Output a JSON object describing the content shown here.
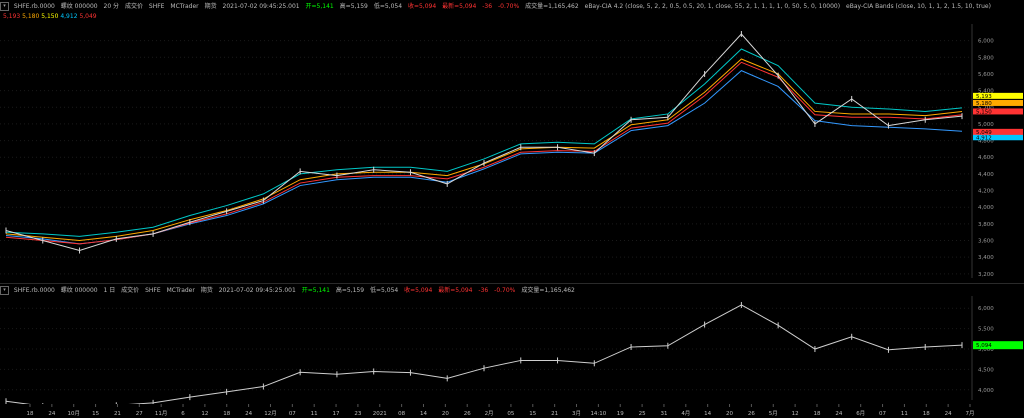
{
  "pane1_header": {
    "symbol": "SHFE.rb.0000",
    "name": "螺纹 000000",
    "interval": "20 分",
    "type": "成交价",
    "feed": "SHFE",
    "platform": "MCTrader",
    "session": "期货",
    "datetime": "2021-07-02  09:45:25.001",
    "open": "开=5,141",
    "high": "高=5,159",
    "low": "低=5,054",
    "close": "收=5,094",
    "last": "最新=5,094",
    "change": "-36",
    "change_pct": "-0.70%",
    "volume": "成交量=1,165,462",
    "strategy": "eBay-CIA 4.2 (close, 5, 2, 2, 0.5, 0.5, 20, 1, close, 55, 2, 1, 1, 1, 1, 0, 50, 5, 0, 10000)",
    "indicator": "eBay-CIA Bands   (close, 10, 1, 1, 2, 1.5, 10, true)",
    "band_values": [
      "5,193",
      "5,180",
      "5,150",
      "4,912",
      "5,049"
    ]
  },
  "pane2_header": {
    "symbol": "SHFE.rb.0000",
    "name": "螺纹 000000",
    "interval": "1 日",
    "type": "成交价",
    "feed": "SHFE",
    "platform": "MCTrader",
    "session": "期货",
    "datetime": "2021-07-02  09:45:25.001",
    "open": "开=5,141",
    "high": "高=5,159",
    "low": "低=5,054",
    "close": "收=5,094",
    "last": "最新=5,094",
    "change": "-36",
    "change_pct": "-0.70%",
    "volume": "成交量=1,165,462"
  },
  "x_axis_labels": [
    "18",
    "24",
    "10月",
    "15",
    "21",
    "27",
    "11月",
    "6",
    "12",
    "18",
    "24",
    "12月",
    "07",
    "11",
    "17",
    "23",
    "2021",
    "08",
    "14",
    "20",
    "26",
    "2月",
    "05",
    "15",
    "21",
    "3月",
    "14:10",
    "19",
    "25",
    "31",
    "4月",
    "14",
    "20",
    "26",
    "5月",
    "12",
    "18",
    "24",
    "6月",
    "07",
    "11",
    "18",
    "24",
    "7月"
  ],
  "chart_data": [
    {
      "type": "line",
      "title": "SHFE.rb.0000 螺纹 000000 20 分",
      "series": [
        {
          "name": "close",
          "color": "#d8d8d8"
        },
        {
          "name": "eBay-CIA Bands",
          "color": "#ff3333"
        }
      ],
      "x": [
        "2020-09-18",
        "2020-10-01",
        "2020-10-15",
        "2020-10-27",
        "2020-11-06",
        "2020-11-18",
        "2020-12-01",
        "2020-12-11",
        "2020-12-23",
        "2021-01-08",
        "2021-01-20",
        "2021-02-01",
        "2021-02-15",
        "2021-02-25",
        "2021-03-10",
        "2021-03-25",
        "2021-04-01",
        "2021-04-14",
        "2021-04-26",
        "2021-05-08",
        "2021-05-12",
        "2021-05-18",
        "2021-05-26",
        "2021-06-07",
        "2021-06-18",
        "2021-06-24",
        "2021-07-02"
      ],
      "close": [
        3720,
        3600,
        3480,
        3620,
        3680,
        3820,
        3950,
        4080,
        4430,
        4380,
        4450,
        4420,
        4280,
        4530,
        4720,
        4720,
        4650,
        5050,
        5080,
        5600,
        6080,
        5580,
        5000,
        5300,
        4980,
        5050,
        5094
      ],
      "bands": {
        "upper": [
          3700,
          3680,
          3650,
          3700,
          3760,
          3900,
          4020,
          4160,
          4400,
          4450,
          4480,
          4480,
          4430,
          4580,
          4760,
          4780,
          4760,
          5060,
          5120,
          5480,
          5900,
          5700,
          5250,
          5200,
          5180,
          5150,
          5193
        ],
        "middle": [
          3680,
          3640,
          3600,
          3650,
          3720,
          3850,
          3960,
          4100,
          4330,
          4400,
          4420,
          4420,
          4380,
          4520,
          4700,
          4720,
          4710,
          4990,
          5050,
          5380,
          5780,
          5600,
          5150,
          5120,
          5120,
          5100,
          5150
        ],
        "lower": [
          3660,
          3620,
          3560,
          3610,
          3680,
          3800,
          3900,
          4040,
          4260,
          4330,
          4360,
          4360,
          4300,
          4460,
          4640,
          4660,
          4650,
          4920,
          4980,
          5250,
          5640,
          5450,
          5040,
          4980,
          4960,
          4940,
          4912
        ]
      },
      "y_ticks": [
        3200,
        3400,
        3600,
        3800,
        4000,
        4200,
        4400,
        4600,
        4800,
        5000,
        5200,
        5400,
        5600,
        5800,
        6000
      ],
      "ylim": [
        3150,
        6200
      ]
    },
    {
      "type": "line",
      "title": "SHFE.rb.0000 螺纹 000000 1 日",
      "series": [
        {
          "name": "daily",
          "color": "#cfcfcf"
        }
      ],
      "x": [
        "2020-09-18",
        "2020-10-01",
        "2020-10-15",
        "2020-10-27",
        "2020-11-06",
        "2020-11-18",
        "2020-12-01",
        "2020-12-11",
        "2020-12-23",
        "2021-01-08",
        "2021-01-20",
        "2021-02-01",
        "2021-02-15",
        "2021-02-25",
        "2021-03-10",
        "2021-03-25",
        "2021-04-01",
        "2021-04-14",
        "2021-04-26",
        "2021-05-08",
        "2021-05-12",
        "2021-05-18",
        "2021-05-26",
        "2021-06-07",
        "2021-06-18",
        "2021-06-24",
        "2021-07-02"
      ],
      "values": [
        3720,
        3600,
        3480,
        3620,
        3680,
        3820,
        3950,
        4080,
        4430,
        4380,
        4450,
        4420,
        4280,
        4530,
        4720,
        4720,
        4650,
        5050,
        5080,
        5600,
        6080,
        5580,
        5000,
        5300,
        4980,
        5050,
        5094
      ],
      "y_ticks": [
        4000,
        4500,
        5000,
        5500,
        6000
      ],
      "ylim": [
        3750,
        6300
      ],
      "last_value": "5,094"
    }
  ],
  "colors": {
    "background": "#000000",
    "price": "#d8d8d8",
    "band_upper": "#00c8c8",
    "band_mid": "#ffaa00",
    "band_lower": "#3399ff",
    "band_red": "#ff3333",
    "up": "#00ff00",
    "down": "#ff3333"
  }
}
